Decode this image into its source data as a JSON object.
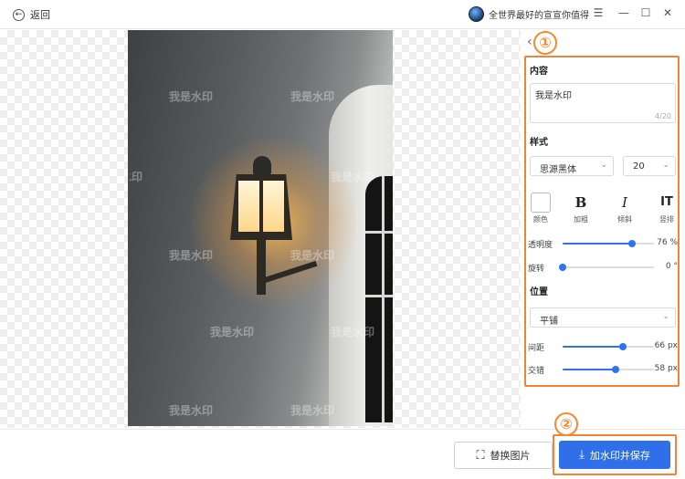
{
  "titlebar": {
    "back_label": "返回",
    "user_name": "全世界最好的宣宣你值得",
    "icons": [
      "back-arrow-icon",
      "avatar",
      "menu-icon",
      "minimize-icon",
      "maximize-icon",
      "close-icon"
    ]
  },
  "canvas": {
    "watermark_text": "我是水印"
  },
  "annotations": {
    "badge_1": "①",
    "badge_2": "②",
    "highlight_color": "#f0843c"
  },
  "panel": {
    "content_title": "内容",
    "content_value": "我是水印",
    "content_count": "4/20",
    "style_title": "样式",
    "font_family": "思源黑体",
    "font_size": "20",
    "color_label": "颜色",
    "bold_glyph": "B",
    "bold_label": "加粗",
    "italic_glyph": "I",
    "italic_label": "倾斜",
    "vertical_glyph": "IT",
    "vertical_label": "竖排",
    "opacity_label": "透明度",
    "opacity_value": "76 %",
    "opacity_percent": 76,
    "rotate_label": "旋转",
    "rotate_value": "0 °",
    "rotate_percent": 0,
    "position_title": "位置",
    "position_mode": "平铺",
    "spacing_label": "间距",
    "spacing_value": "66 px",
    "spacing_percent": 66,
    "offset_label": "交错",
    "offset_value": "58 px",
    "offset_percent": 58,
    "accent_color": "#2f73f0"
  },
  "footer": {
    "replace_label": "替换图片",
    "save_label": "加水印并保存",
    "save_color": "#2f6fe8"
  }
}
